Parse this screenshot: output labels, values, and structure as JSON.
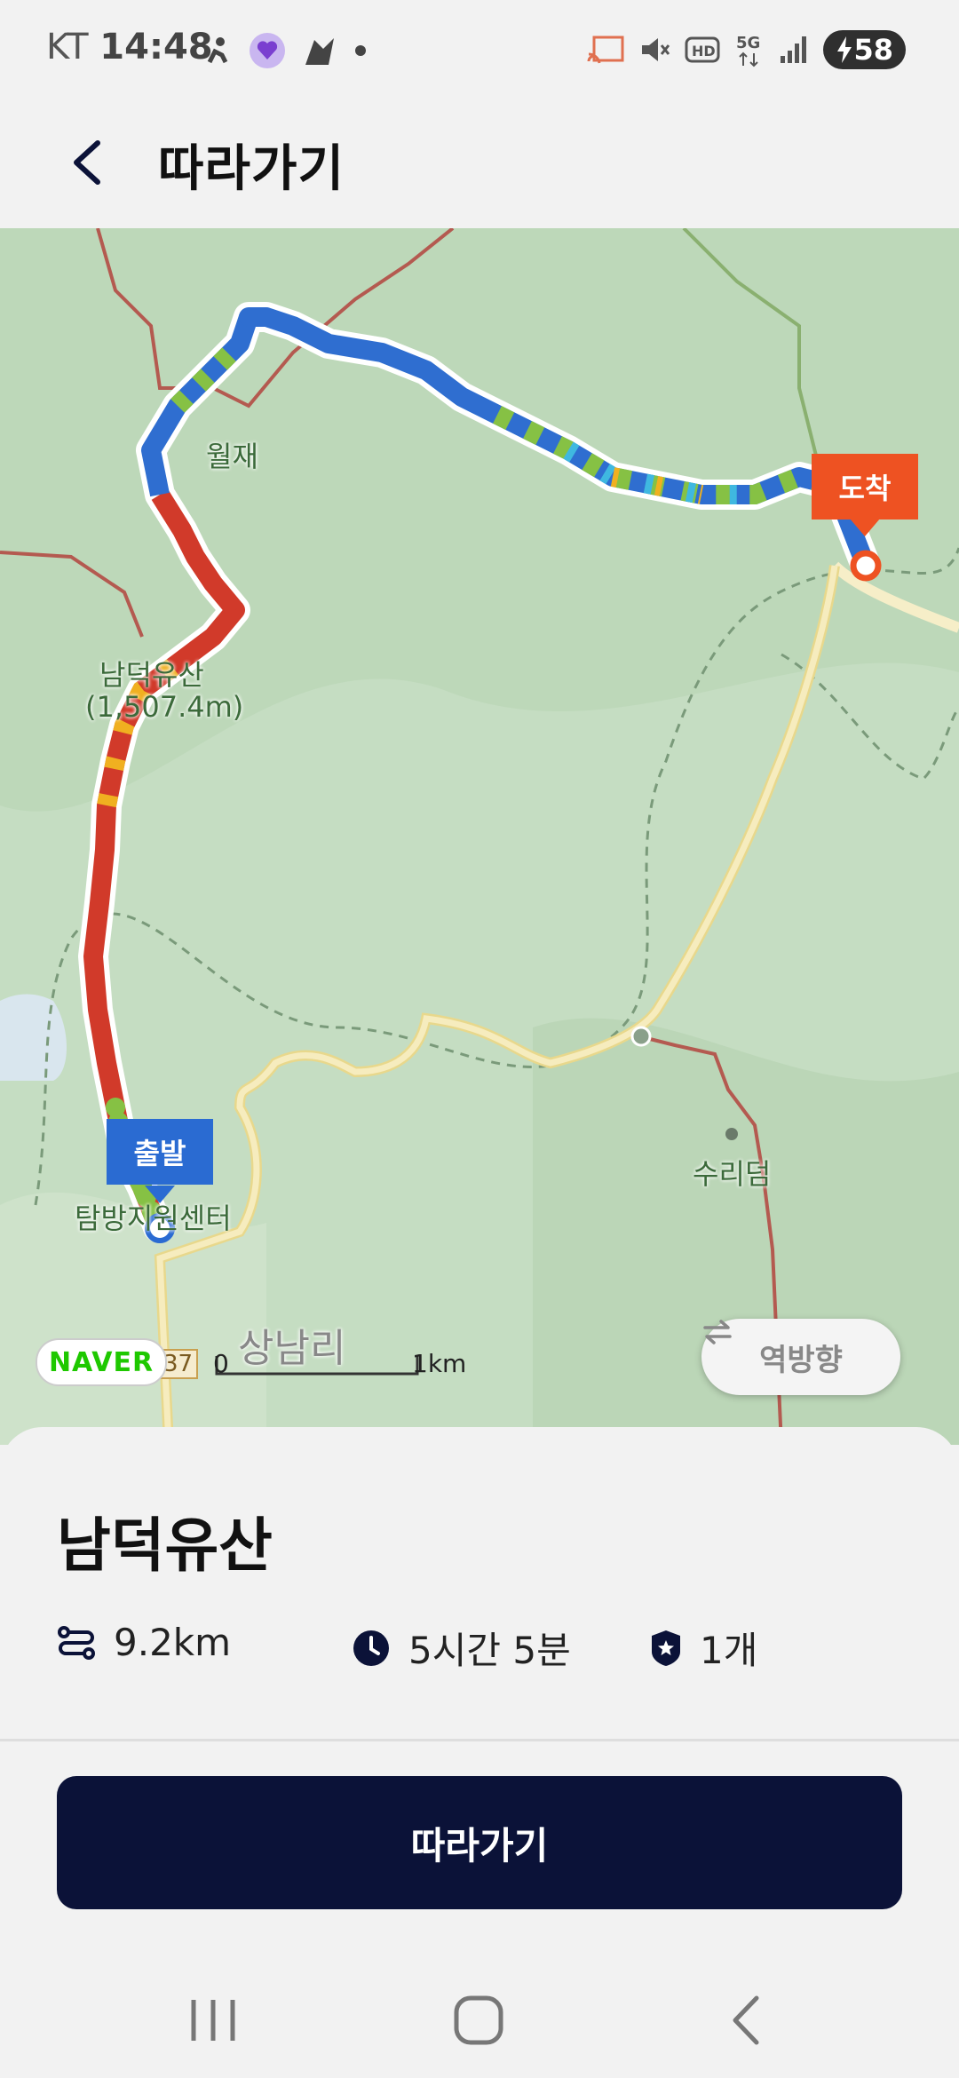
{
  "status_bar": {
    "carrier": "KT",
    "time": "14:48",
    "battery": "58"
  },
  "header": {
    "title": "따라가기"
  },
  "map": {
    "start_marker": "출발",
    "end_marker": "도착",
    "labels": {
      "pass": "월재",
      "peak": "남덕유산",
      "peak_alt": "(1,507.4m)",
      "center": "탐방지원센터",
      "village": "상남리",
      "dam": "수리덤",
      "road_no": "37"
    },
    "logo": "NAVER",
    "scale": {
      "min": "0",
      "max": "1km"
    },
    "reverse_button": "역방향"
  },
  "route": {
    "name": "남덕유산",
    "distance": "9.2km",
    "duration": "5시간 5분",
    "checkpoints": "1개"
  },
  "actions": {
    "follow_button": "따라가기"
  },
  "colors": {
    "primary": "#0b1238",
    "start_marker": "#2a6bd2",
    "end_marker": "#ee5222",
    "naver_green": "#1ec800"
  },
  "icons": [
    "back-arrow-icon",
    "distance-icon",
    "clock-icon",
    "badge-icon",
    "swap-icon",
    "recents-icon",
    "home-icon",
    "nav-back-icon"
  ]
}
